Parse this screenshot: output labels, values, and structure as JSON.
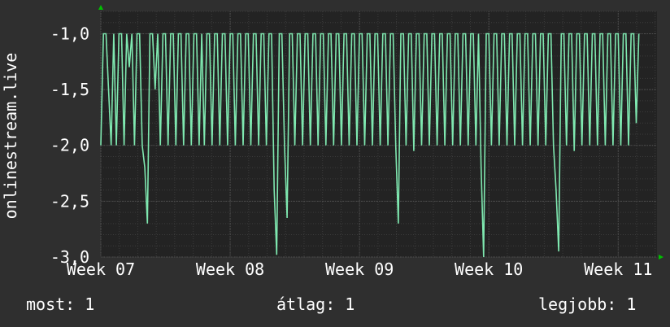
{
  "chart_data": {
    "type": "line",
    "ylabel": "onlinestream.live",
    "ylim": [
      -3.0,
      -0.8
    ],
    "y_ticks": [
      "-1,0",
      "-1,5",
      "-2,0",
      "-2,5",
      "-3,0"
    ],
    "y_tick_values": [
      -1.0,
      -1.5,
      -2.0,
      -2.5,
      -3.0
    ],
    "x_ticks": [
      "Week 07",
      "Week 08",
      "Week 09",
      "Week 10",
      "Week 11"
    ],
    "x_tick_weeks": [
      7,
      8,
      9,
      10,
      11
    ],
    "x_range_weeks": [
      7,
      11.3
    ],
    "grid": true,
    "series": [
      {
        "color": "#7fe8b0",
        "x_weeks": [
          7.0,
          7.02,
          7.04,
          7.06,
          7.08,
          7.1,
          7.12,
          7.14,
          7.16,
          7.18,
          7.2,
          7.22,
          7.24,
          7.26,
          7.28,
          7.3,
          7.32,
          7.34,
          7.36,
          7.38,
          7.4,
          7.42,
          7.44,
          7.46,
          7.48,
          7.5,
          7.52,
          7.54,
          7.56,
          7.58,
          7.6,
          7.62,
          7.64,
          7.66,
          7.68,
          7.7,
          7.72,
          7.74,
          7.76,
          7.78,
          7.8,
          7.82,
          7.84,
          7.86,
          7.88,
          7.9,
          7.92,
          7.94,
          7.96,
          7.98,
          8.0,
          8.02,
          8.04,
          8.06,
          8.08,
          8.1,
          8.12,
          8.14,
          8.16,
          8.18,
          8.2,
          8.22,
          8.24,
          8.26,
          8.28,
          8.3,
          8.32,
          8.34,
          8.36,
          8.38,
          8.4,
          8.42,
          8.44,
          8.46,
          8.48,
          8.5,
          8.52,
          8.54,
          8.56,
          8.58,
          8.6,
          8.62,
          8.64,
          8.66,
          8.68,
          8.7,
          8.72,
          8.74,
          8.76,
          8.78,
          8.8,
          8.82,
          8.84,
          8.86,
          8.88,
          8.9,
          8.92,
          8.94,
          8.96,
          8.98,
          9.0,
          9.02,
          9.04,
          9.06,
          9.08,
          9.1,
          9.12,
          9.14,
          9.16,
          9.18,
          9.2,
          9.22,
          9.24,
          9.26,
          9.28,
          9.3,
          9.32,
          9.34,
          9.36,
          9.38,
          9.4,
          9.42,
          9.44,
          9.46,
          9.48,
          9.5,
          9.52,
          9.54,
          9.56,
          9.58,
          9.6,
          9.62,
          9.64,
          9.66,
          9.68,
          9.7,
          9.72,
          9.74,
          9.76,
          9.78,
          9.8,
          9.82,
          9.84,
          9.86,
          9.88,
          9.9,
          9.92,
          9.94,
          9.96,
          9.98,
          10.0,
          10.02,
          10.04,
          10.06,
          10.08,
          10.1,
          10.12,
          10.14,
          10.16,
          10.18,
          10.2,
          10.22,
          10.24,
          10.26,
          10.28,
          10.3,
          10.32,
          10.34,
          10.36,
          10.38,
          10.4,
          10.42,
          10.44,
          10.46,
          10.48,
          10.5,
          10.52,
          10.54,
          10.56,
          10.58,
          10.6,
          10.62,
          10.64,
          10.66,
          10.68,
          10.7,
          10.72,
          10.74,
          10.76,
          10.78,
          10.8,
          10.82,
          10.84,
          10.86,
          10.88,
          10.9,
          10.92,
          10.94,
          10.96,
          10.98,
          11.0,
          11.02,
          11.04,
          11.06,
          11.08,
          11.1,
          11.12,
          11.14,
          11.16,
          11.18,
          11.2,
          11.22,
          11.24,
          11.26,
          11.28,
          11.3
        ],
        "y": [
          -2.0,
          -1.0,
          -1.0,
          -1.5,
          -2.0,
          -1.0,
          -2.0,
          -1.0,
          -1.0,
          -2.0,
          -1.0,
          -1.3,
          -1.0,
          -2.0,
          -1.0,
          -1.0,
          -2.0,
          -2.2,
          -2.7,
          -1.0,
          -1.0,
          -1.5,
          -1.0,
          -2.0,
          -1.0,
          -1.0,
          -2.0,
          -1.0,
          -1.0,
          -2.0,
          -1.0,
          -1.0,
          -2.0,
          -1.0,
          -1.0,
          -2.0,
          -1.0,
          -1.0,
          -2.0,
          -1.0,
          -2.0,
          -1.0,
          -1.0,
          -2.0,
          -1.0,
          -1.0,
          -2.0,
          -1.0,
          -1.0,
          -2.0,
          -1.0,
          -1.0,
          -2.0,
          -1.0,
          -1.0,
          -2.0,
          -1.0,
          -1.0,
          -2.0,
          -1.0,
          -1.0,
          -2.0,
          -1.0,
          -1.0,
          -2.0,
          -1.0,
          -1.0,
          -2.4,
          -2.98,
          -1.0,
          -1.0,
          -2.0,
          -2.65,
          -1.0,
          -1.0,
          -2.0,
          -1.0,
          -1.0,
          -2.0,
          -1.0,
          -1.0,
          -2.0,
          -1.0,
          -1.0,
          -2.0,
          -1.0,
          -1.0,
          -2.0,
          -1.0,
          -1.0,
          -2.0,
          -1.0,
          -1.0,
          -2.0,
          -1.0,
          -1.0,
          -2.0,
          -1.0,
          -1.0,
          -2.0,
          -1.0,
          -1.0,
          -2.0,
          -1.0,
          -1.0,
          -2.0,
          -1.0,
          -1.0,
          -2.0,
          -1.0,
          -1.0,
          -2.0,
          -1.0,
          -1.0,
          -2.0,
          -2.7,
          -1.0,
          -1.0,
          -2.0,
          -1.0,
          -1.0,
          -2.05,
          -1.0,
          -1.0,
          -2.0,
          -1.0,
          -1.0,
          -2.0,
          -1.0,
          -1.0,
          -2.0,
          -1.0,
          -1.0,
          -2.0,
          -1.0,
          -1.0,
          -2.0,
          -1.0,
          -1.0,
          -2.0,
          -1.0,
          -1.0,
          -2.0,
          -1.0,
          -1.0,
          -2.0,
          -1.0,
          -2.2,
          -3.0,
          -1.0,
          -1.0,
          -2.0,
          -1.0,
          -1.0,
          -2.0,
          -1.0,
          -1.0,
          -2.0,
          -1.0,
          -1.0,
          -2.0,
          -1.0,
          -1.0,
          -2.0,
          -1.0,
          -1.0,
          -2.0,
          -1.0,
          -1.0,
          -2.0,
          -1.0,
          -1.0,
          -2.0,
          -1.0,
          -1.0,
          -2.0,
          -2.4,
          -2.95,
          -1.0,
          -1.0,
          -2.0,
          -1.0,
          -1.0,
          -2.05,
          -1.0,
          -1.0,
          -2.0,
          -1.0,
          -1.0,
          -2.0,
          -1.0,
          -1.0,
          -2.0,
          -1.0,
          -1.0,
          -2.0,
          -1.0,
          -1.0,
          -2.0,
          -1.0,
          -1.0,
          -2.0,
          -1.0,
          -1.0,
          -2.0,
          -1.0,
          -1.0,
          -1.8,
          -1.0
        ]
      }
    ]
  },
  "legend": {
    "current": "most: 1",
    "average": "átlag: 1",
    "max": "legjobb: 1"
  },
  "colors": {
    "background": "#2f2f2f",
    "plot_background": "#232323",
    "grid_major": "#505050",
    "grid_minor": "#3c3c3c",
    "axis_arrow": "#00c000",
    "text": "#ffffff"
  }
}
